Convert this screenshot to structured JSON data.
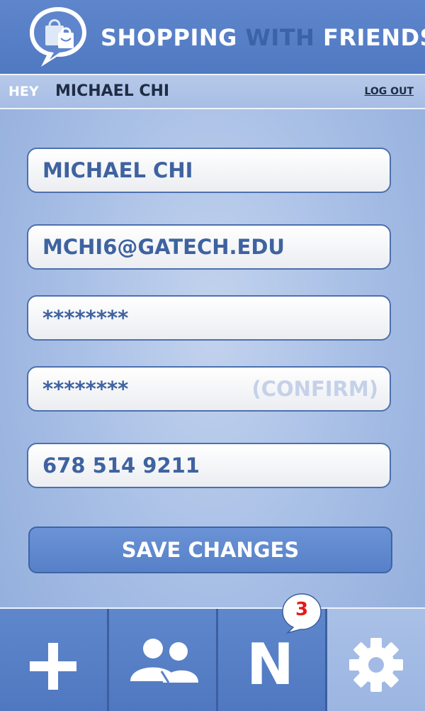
{
  "header": {
    "title_part1": "SHOPPING",
    "title_part2": "WITH",
    "title_part3": "FRIENDS",
    "logo_icon": "shopping-bag-speech-bubble-icon"
  },
  "subbar": {
    "greeting": "HEY",
    "username": "MICHAEL CHI",
    "logout_label": "LOG OUT"
  },
  "form": {
    "name_value": "MICHAEL CHI",
    "email_value": "MCHI6@GATECH.EDU",
    "password_value": "********",
    "confirm_value": "********",
    "confirm_hint": "(CONFIRM)",
    "phone_value": "678 514 9211",
    "save_label": "SAVE CHANGES"
  },
  "tabbar": {
    "tabs": [
      {
        "icon": "plus-icon",
        "active": false
      },
      {
        "icon": "friends-icon",
        "active": false
      },
      {
        "icon": "notifications-icon",
        "label": "N",
        "active": false,
        "badge": "3"
      },
      {
        "icon": "gear-icon",
        "active": true
      }
    ]
  },
  "colors": {
    "header_blue": "#5b82c8",
    "text_blue": "#3f63a0",
    "badge_red": "#e31b1b",
    "background": "#a9c0e6"
  }
}
